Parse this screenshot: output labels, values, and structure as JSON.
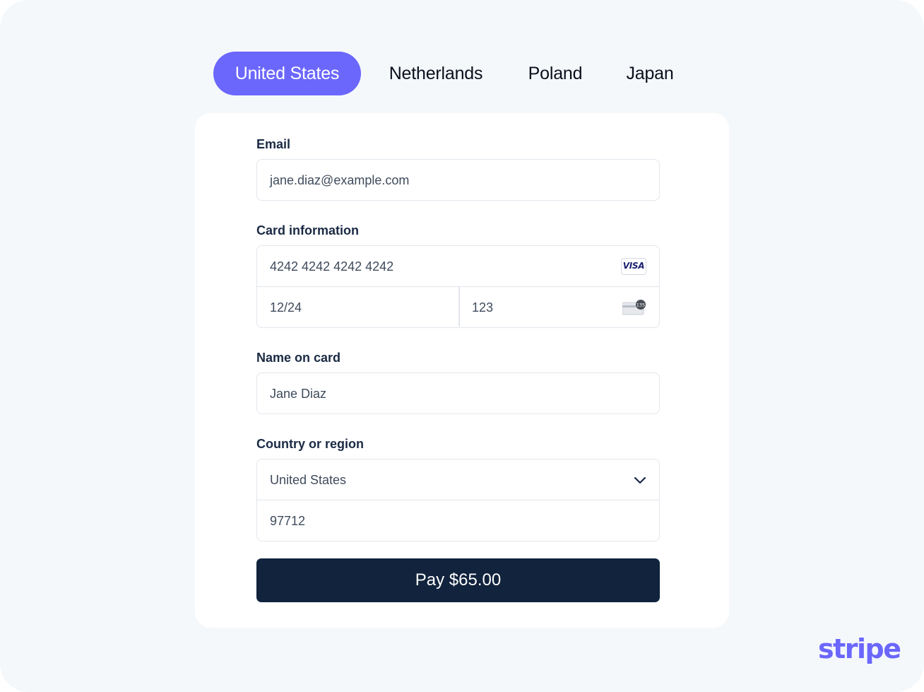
{
  "tabs": [
    {
      "label": "United States",
      "active": true
    },
    {
      "label": "Netherlands",
      "active": false
    },
    {
      "label": "Poland",
      "active": false
    },
    {
      "label": "Japan",
      "active": false
    }
  ],
  "form": {
    "email": {
      "label": "Email",
      "value": "jane.diaz@example.com"
    },
    "card": {
      "label": "Card information",
      "number": "4242 4242 4242 4242",
      "brand": "VISA",
      "brand_icon": "visa-card-icon",
      "expiry": "12/24",
      "cvc": "123",
      "cvc_icon": "cvc-card-icon",
      "cvc_icon_text": "135"
    },
    "name": {
      "label": "Name on card",
      "value": "Jane Diaz"
    },
    "country": {
      "label": "Country or region",
      "selected": "United States",
      "postal": "97712",
      "dropdown_icon": "chevron-down-icon"
    },
    "pay_button": {
      "label": "Pay $65.00"
    }
  },
  "branding": {
    "logo": "stripe"
  },
  "colors": {
    "accent": "#6b67fc",
    "button": "#11233d",
    "background": "#f5f8fb"
  }
}
